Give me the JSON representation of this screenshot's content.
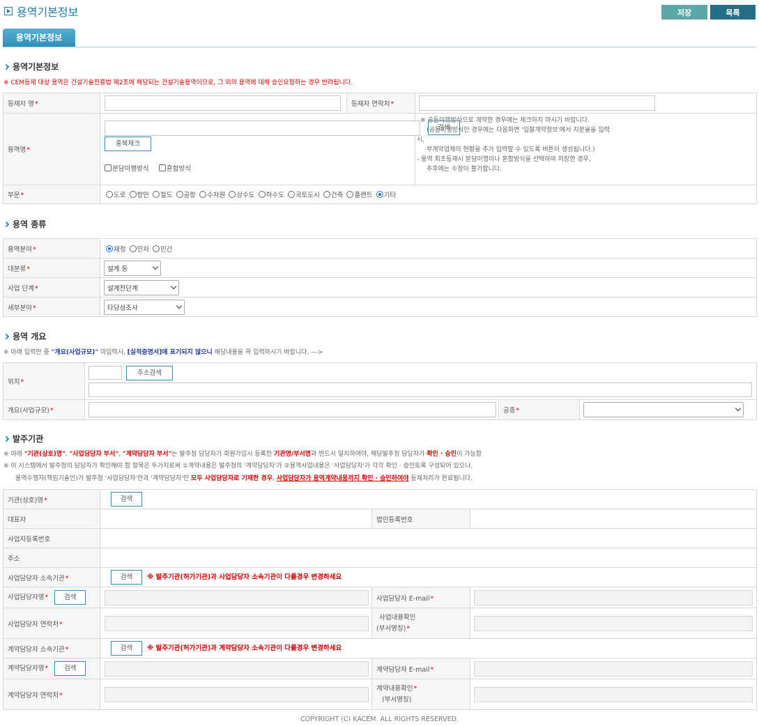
{
  "header": {
    "title": "용역기본정보",
    "save_label": "저장",
    "list_label": "목록"
  },
  "tab": {
    "label": "용역기본정보"
  },
  "sections": {
    "basic": {
      "title": "용역기본정보",
      "notice": "※ CEM등재 대상 용역은 건설기술진흥법 제2조에 해당되는 건설기술용역이므로, 그 외의 용역에 대해 승인요청하는 경우 반려됩니다."
    },
    "type": {
      "title": "용역 종류"
    },
    "overview": {
      "title": "용역 개요"
    },
    "client": {
      "title": "발주기관"
    }
  },
  "basic_form": {
    "registrant_name_label": "등재자 명",
    "registrant_contact_label": "등재자 연락처",
    "service_name_label": "용역명",
    "search_label": "검색",
    "dup_check_label": "중복체크",
    "checkbox_split": "분담이행방식",
    "checkbox_mixed": "혼합방식",
    "notes": [
      "※ 공동이행방식으로 계약한 경우에는 체크하지 마시기 바랍니다.",
      "(공동이행방식인 경우에는 다음화면 '입찰계약정보'에서 지분율을 입력",
      "시,",
      "부계약업체의 현황을 추가 입력할 수 있도록 버튼이 생성됩니다.)",
      "- 용역 최초등재시 분담이행이나 혼합방식을 선택하여 저장한 경우,",
      "추후에는 수정이 불가합니다."
    ],
    "sector_label": "부문",
    "sector_options": [
      "도로",
      "항만",
      "철도",
      "공항",
      "수자원",
      "상수도",
      "하수도",
      "국토도시",
      "건축",
      "플랜트",
      "기타"
    ],
    "sector_selected": "기타"
  },
  "type_form": {
    "field_label": "용역분야",
    "field_options": [
      "재정",
      "민자",
      "민간"
    ],
    "field_selected": "재정",
    "major_label": "대분류",
    "major_value": "설계 등",
    "stage_label": "사업 단계",
    "stage_value": "설계전단계",
    "sub_label": "세부분야",
    "sub_value": "타당성조사"
  },
  "overview_form": {
    "notice_parts": [
      "※ 아래 입력란 중 ",
      "\"개요(사업규모)\"",
      " 미입력시, ",
      "[실적증명서]에 표기되지 않으니",
      " 해당내용을 꼭 입력하시기 바랍니다. --->"
    ],
    "location_label": "위치",
    "address_search_label": "주소검색",
    "scale_label": "개요(사업규모)",
    "work_type_label": "공종"
  },
  "client_form": {
    "notice1_parts": [
      "※ 아래 ",
      "\"기관(상호)명\"",
      ", ",
      "\"사업담당자 부서\"",
      ", ",
      "\"계약담당자 부서\"",
      "는 발주청 담당자가 회원가입시 등록한 ",
      "기관명/부서명",
      "과 반드시 일치하여야, 해당발주청 담당자가 ",
      "확인 · 승인",
      "이 가능함"
    ],
    "notice2": "※ 이 시스템에서 발주청의 담당자가 확인해야 할 항목은 두가지로써 ①계약내용은 발주청의 '계약담당자'가 ②용역사업내용은 '사업담당자'가 각각 확인 · 승인토록 구성되어 있으나,",
    "notice3_parts": [
      "용역수행자(책임기술인)가 발주청 '사업담당자'란과 '계약담당자'란 ",
      "모두 사업담당자로 기재한 경우",
      ", ",
      "사업담당자가 용역계약내용까지 확인 · 승인하여야",
      " 등재처리가 완료됩니다."
    ],
    "org_label": "기관(상호)명",
    "ceo_label": "대표자",
    "corp_no_label": "법인등록번호",
    "biz_no_label": "사업자등록번호",
    "address_label": "주소",
    "biz_org_label": "사업담당자 소속기관",
    "biz_org_warn": "※ 발주기관(허가기관)과 사업담당자 소속기관이 다를경우 변경하세요",
    "biz_name_label": "사업담당자명",
    "biz_email_label": "사업담당자 E-mail",
    "biz_contact_label": "사업담당자 연락처",
    "biz_confirm_label_1": "사업내용확인",
    "biz_confirm_label_2": "(부서명칭)",
    "con_org_label": "계약담당자 소속기관",
    "con_org_warn": "※ 발주기관(허가기관)과 계약담당자 소속기관이 다를경우 변경하세요",
    "con_name_label": "계약담당자명",
    "con_email_label": "계약담당자 E-mail",
    "con_contact_label": "계약담당자 연락처",
    "con_confirm_label_1": "계약내용확인",
    "con_confirm_label_2": "(부서명칭)",
    "search_label": "검색"
  },
  "footer": {
    "copyright": "COPYRIGHT (C) KACEM.  ALL RIGHTS RESERVED."
  }
}
